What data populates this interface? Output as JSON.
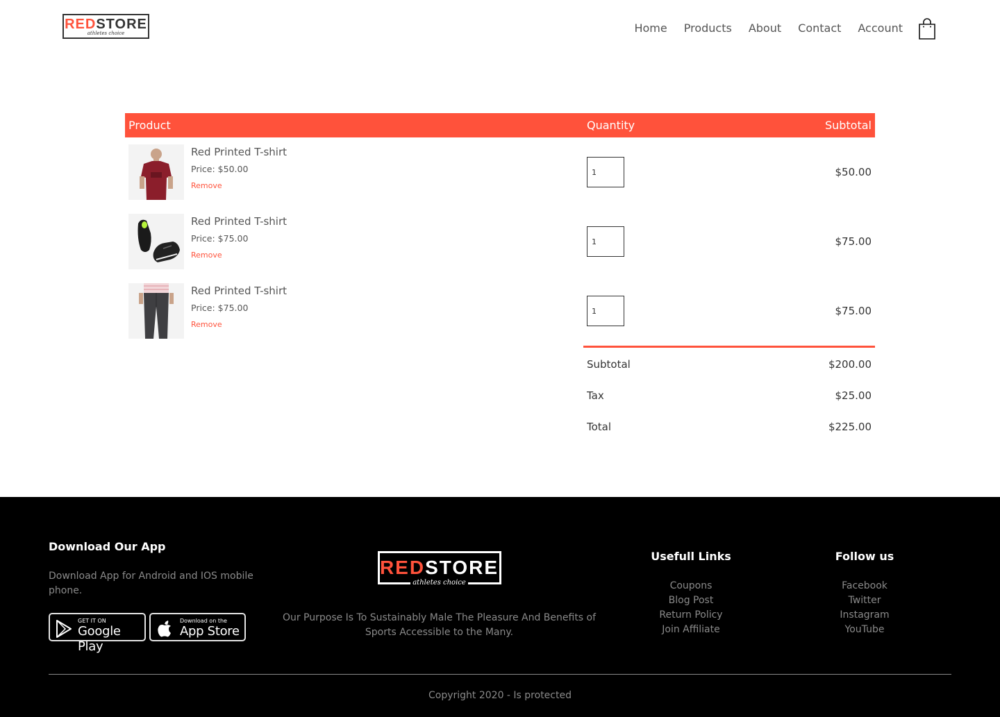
{
  "brand": {
    "name_red": "RED",
    "name_rest": "STORE",
    "tagline": "athletes choice",
    "accent_color": "#ff523b"
  },
  "nav": {
    "items": [
      "Home",
      "Products",
      "About",
      "Contact",
      "Account"
    ],
    "cart_icon": "shopping-bag-icon"
  },
  "cart": {
    "headers": {
      "product": "Product",
      "quantity": "Quantity",
      "subtotal": "Subtotal"
    },
    "items": [
      {
        "name": "Red Printed T-shirt",
        "price": "Price: $50.00",
        "remove": "Remove",
        "quantity": "1",
        "subtotal": "$50.00",
        "image": "red-tshirt-photo"
      },
      {
        "name": "Red Printed T-shirt",
        "price": "Price: $75.00",
        "remove": "Remove",
        "quantity": "1",
        "subtotal": "$75.00",
        "image": "black-sneakers-photo"
      },
      {
        "name": "Red Printed T-shirt",
        "price": "Price: $75.00",
        "remove": "Remove",
        "quantity": "1",
        "subtotal": "$75.00",
        "image": "grey-joggers-photo"
      }
    ],
    "totals": [
      {
        "label": "Subtotal",
        "value": "$200.00"
      },
      {
        "label": "Tax",
        "value": "$25.00"
      },
      {
        "label": "Total",
        "value": "$225.00"
      }
    ]
  },
  "footer": {
    "app": {
      "title": "Download Our App",
      "text": "Download App for Android and IOS mobile phone.",
      "google_small": "GET IT ON",
      "google_big": "Google Play",
      "apple_small": "Download on the",
      "apple_big": "App Store"
    },
    "purpose": "Our Purpose Is To Sustainably Male The Pleasure And Benefits of Sports Accessible to the Many.",
    "links": {
      "title": "Usefull Links",
      "items": [
        "Coupons",
        "Blog Post",
        "Return Policy",
        "Join Affiliate"
      ]
    },
    "follow": {
      "title": "Follow us",
      "items": [
        "Facebook",
        "Twitter",
        "Instagram",
        "YouTube"
      ]
    },
    "copyright": "Copyright 2020 - Is protected"
  }
}
